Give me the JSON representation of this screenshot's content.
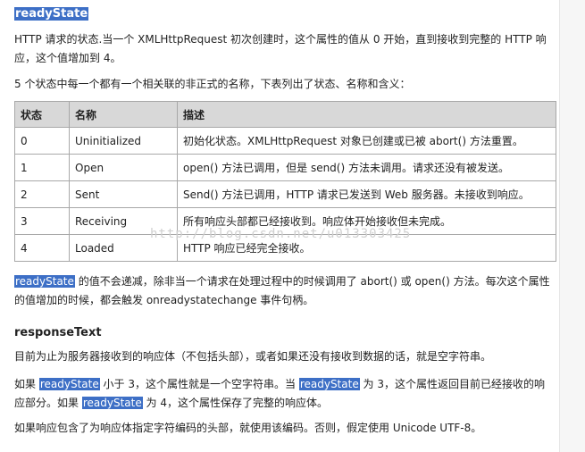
{
  "heading": "readyState",
  "intro": "HTTP 请求的状态.当一个 XMLHttpRequest 初次创建时，这个属性的值从 0 开始，直到接收到完整的 HTTP 响应，这个值增加到 4。",
  "table_intro": "5 个状态中每一个都有一个相关联的非正式的名称，下表列出了状态、名称和含义：",
  "table": {
    "headers": [
      "状态",
      "名称",
      "描述"
    ],
    "rows": [
      [
        "0",
        "Uninitialized",
        "初始化状态。XMLHttpRequest 对象已创建或已被 abort() 方法重置。"
      ],
      [
        "1",
        "Open",
        "open() 方法已调用，但是 send() 方法未调用。请求还没有被发送。"
      ],
      [
        "2",
        "Sent",
        "Send() 方法已调用，HTTP 请求已发送到 Web 服务器。未接收到响应。"
      ],
      [
        "3",
        "Receiving",
        "所有响应头部都已经接收到。响应体开始接收但未完成。"
      ],
      [
        "4",
        "Loaded",
        "HTTP 响应已经完全接收。"
      ]
    ]
  },
  "watermark": "http://blog.csdn.net/u013303425",
  "p1": {
    "hl": "readyState",
    "rest": " 的值不会递减，除非当一个请求在处理过程中的时候调用了 abort() 或 open() 方法。每次这个属性的值增加的时候，都会触发 onreadystatechange 事件句柄。"
  },
  "heading2": "responseText",
  "p2": "目前为止为服务器接收到的响应体（不包括头部），或者如果还没有接收到数据的话，就是空字符串。",
  "p3": {
    "a": "如果 ",
    "hl1": "readyState",
    "b": " 小于 3，这个属性就是一个空字符串。当 ",
    "hl2": "readyState",
    "c": " 为 3，这个属性返回目前已经接收的响应部分。如果 ",
    "hl3": "readyState",
    "d": " 为 4，这个属性保存了完整的响应体。"
  },
  "p4": "如果响应包含了为响应体指定字符编码的头部，就使用该编码。否则，假定使用 Unicode UTF-8。"
}
